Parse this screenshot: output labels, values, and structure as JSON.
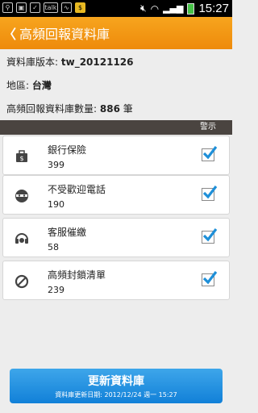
{
  "statusbar": {
    "time": "15:27",
    "icons": [
      "usb-icon",
      "image-icon",
      "ok-icon",
      "talk-icon",
      "pulse-icon",
      "coin-icon",
      "mute-icon",
      "wifi-icon",
      "signal-icon",
      "battery-icon"
    ],
    "talk_label": "talk"
  },
  "header": {
    "back_label": "〈",
    "title": "高頻回報資料庫"
  },
  "info": {
    "version_label": "資料庫版本:",
    "version_value": "tw_20121126",
    "region_label": "地區:",
    "region_value": "台灣",
    "count_label": "高頻回報資料庫數量:",
    "count_value": "886",
    "count_unit": "筆"
  },
  "warn_label": "警示",
  "categories": [
    {
      "label": "銀行保險",
      "count": "399",
      "icon": "bank-insurance-icon",
      "checked": true
    },
    {
      "label": "不受歡迎電話",
      "count": "190",
      "icon": "unwanted-call-icon",
      "checked": true
    },
    {
      "label": "客服催繳",
      "count": "58",
      "icon": "customer-service-icon",
      "checked": true
    },
    {
      "label": "高頻封鎖清單",
      "count": "239",
      "icon": "block-list-icon",
      "checked": true
    }
  ],
  "update_button": {
    "label": "更新資料庫",
    "last_updated": "資料庫更新日期: 2012/12/24 週一 15:27"
  },
  "colors": {
    "header": "#f29913",
    "button": "#1f8fe0",
    "check": "#1e8fd8"
  }
}
